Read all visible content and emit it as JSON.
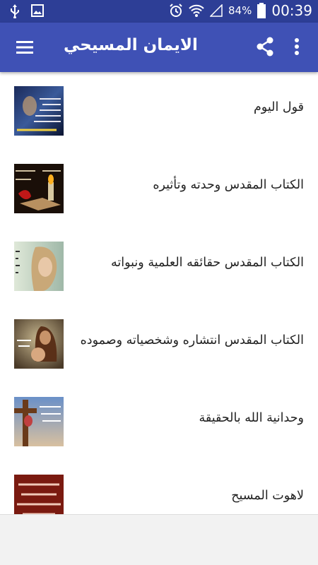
{
  "status_bar": {
    "battery": "84%",
    "time": "00:39"
  },
  "toolbar": {
    "title": "الايمان المسيحي",
    "icons": [
      "menu-icon",
      "share-icon",
      "more-vert-icon"
    ]
  },
  "items": [
    {
      "label": "قول اليوم",
      "thumb": "quote-image"
    },
    {
      "label": "الكتاب المقدس وحدته وتأثيره",
      "thumb": "bible-candle-image"
    },
    {
      "label": "الكتاب المقدس حقائقه العلمية ونبواته",
      "thumb": "girl-image"
    },
    {
      "label": "الكتاب المقدس انتشاره وشخصياته وصموده",
      "thumb": "jesus-child-image"
    },
    {
      "label": "وحدانية الله بالحقيقة",
      "thumb": "cross-image"
    },
    {
      "label": "لاهوت المسيح",
      "thumb": "red-text-image"
    }
  ],
  "colors": {
    "status_bar": "#2d3e96",
    "toolbar": "#3f51b5",
    "background": "#ffffff"
  }
}
